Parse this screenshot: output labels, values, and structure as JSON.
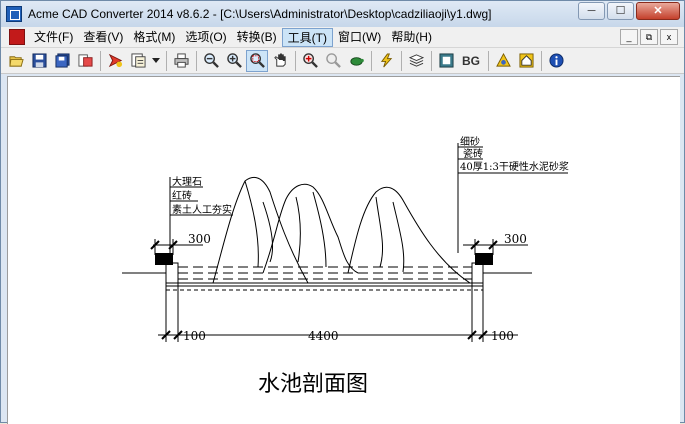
{
  "window": {
    "title": "Acme CAD Converter 2014 v8.6.2 - [C:\\Users\\Administrator\\Desktop\\cadziliaoji\\y1.dwg]",
    "controls": [
      "─",
      "☐",
      "✕"
    ]
  },
  "menubar": {
    "items": [
      {
        "label": "文件(F)"
      },
      {
        "label": "查看(V)"
      },
      {
        "label": "格式(M)"
      },
      {
        "label": "选项(O)"
      },
      {
        "label": "转换(B)"
      },
      {
        "label": "工具(T)"
      },
      {
        "label": "窗口(W)"
      },
      {
        "label": "帮助(H)"
      }
    ],
    "active_index": 5,
    "mdi_controls": [
      "_",
      "⧉",
      "x"
    ]
  },
  "toolbar": {
    "bg_label": "BG",
    "icons": [
      "open-icon",
      "save-icon",
      "save-all-icon",
      "convert-icon",
      "batch-icon",
      "layout-icon",
      "dropdown-icon",
      "print-icon",
      "zoom-out-icon",
      "zoom-in-icon",
      "zoom-window-icon",
      "pan-icon",
      "zoom-extents-icon",
      "zoom-realtime-icon",
      "turtle-icon",
      "lightning-icon",
      "layers-icon",
      "background-icon",
      "bg-icon",
      "properties-icon",
      "home-icon",
      "about-icon"
    ]
  },
  "drawing": {
    "title": "水池剖面图",
    "dim_left_top": "300",
    "dim_right_top": "300",
    "dim_bottom_left": "100",
    "dim_bottom_mid": "4400",
    "dim_bottom_right": "100",
    "left_note": [
      "大理石",
      "红砖",
      "素土人工夯实"
    ],
    "right_note": [
      "细砂",
      "瓷砖",
      "40厚1:3干硬性水泥砂浆"
    ]
  }
}
